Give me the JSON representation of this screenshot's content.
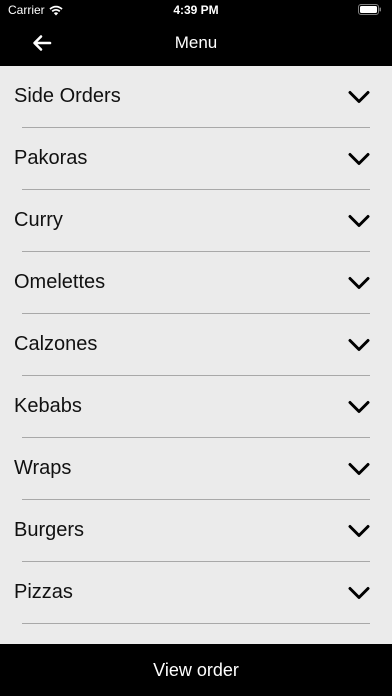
{
  "status_bar": {
    "carrier": "Carrier",
    "time": "4:39 PM",
    "icons": [
      "wifi-icon",
      "battery-icon"
    ]
  },
  "nav": {
    "title": "Menu",
    "back_icon": "arrow-left-icon"
  },
  "menu": {
    "items": [
      {
        "label": "Side Orders"
      },
      {
        "label": "Pakoras"
      },
      {
        "label": "Curry"
      },
      {
        "label": "Omelettes"
      },
      {
        "label": "Calzones"
      },
      {
        "label": "Kebabs"
      },
      {
        "label": "Wraps"
      },
      {
        "label": "Burgers"
      },
      {
        "label": "Pizzas"
      }
    ],
    "expand_icon": "chevron-down-icon"
  },
  "footer": {
    "view_order_label": "View order"
  },
  "colors": {
    "bar_background": "#000000",
    "list_background": "#ebebeb",
    "divider": "#a8a8a8"
  }
}
